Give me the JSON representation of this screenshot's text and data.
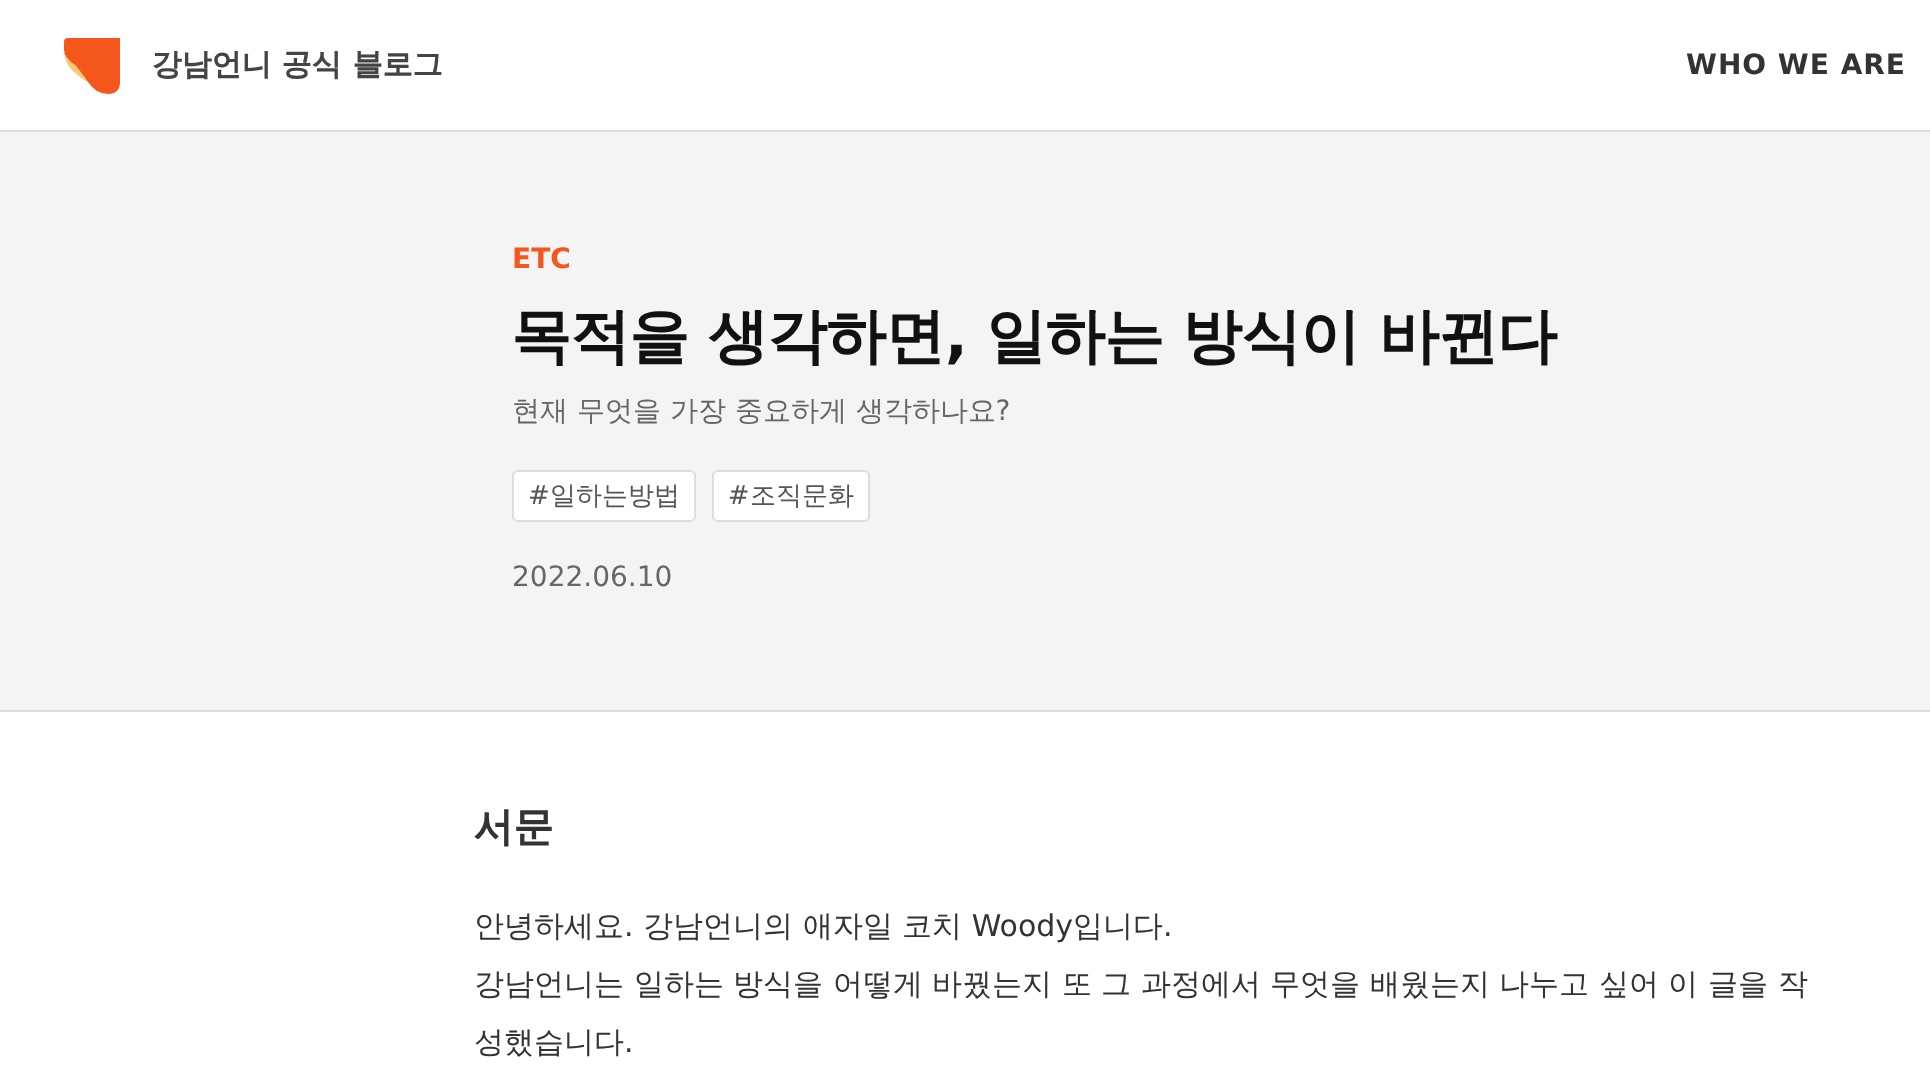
{
  "header": {
    "blog_title": "강남언니 공식 블로그",
    "nav_link": "WHO WE ARE"
  },
  "hero": {
    "category": "ETC",
    "title": "목적을 생각하면, 일하는 방식이 바뀐다",
    "subtitle": "현재 무엇을 가장 중요하게 생각하나요?",
    "tags": [
      "#일하는방법",
      "#조직문화"
    ],
    "date": "2022.06.10"
  },
  "article": {
    "heading": "서문",
    "paragraphs": [
      "안녕하세요. 강남언니의 애자일 코치 Woody입니다.",
      "강남언니는 일하는 방식을 어떻게 바꿨는지 또 그 과정에서 무엇을 배웠는지 나누고 싶어 이 글을 작성했습니다."
    ]
  }
}
